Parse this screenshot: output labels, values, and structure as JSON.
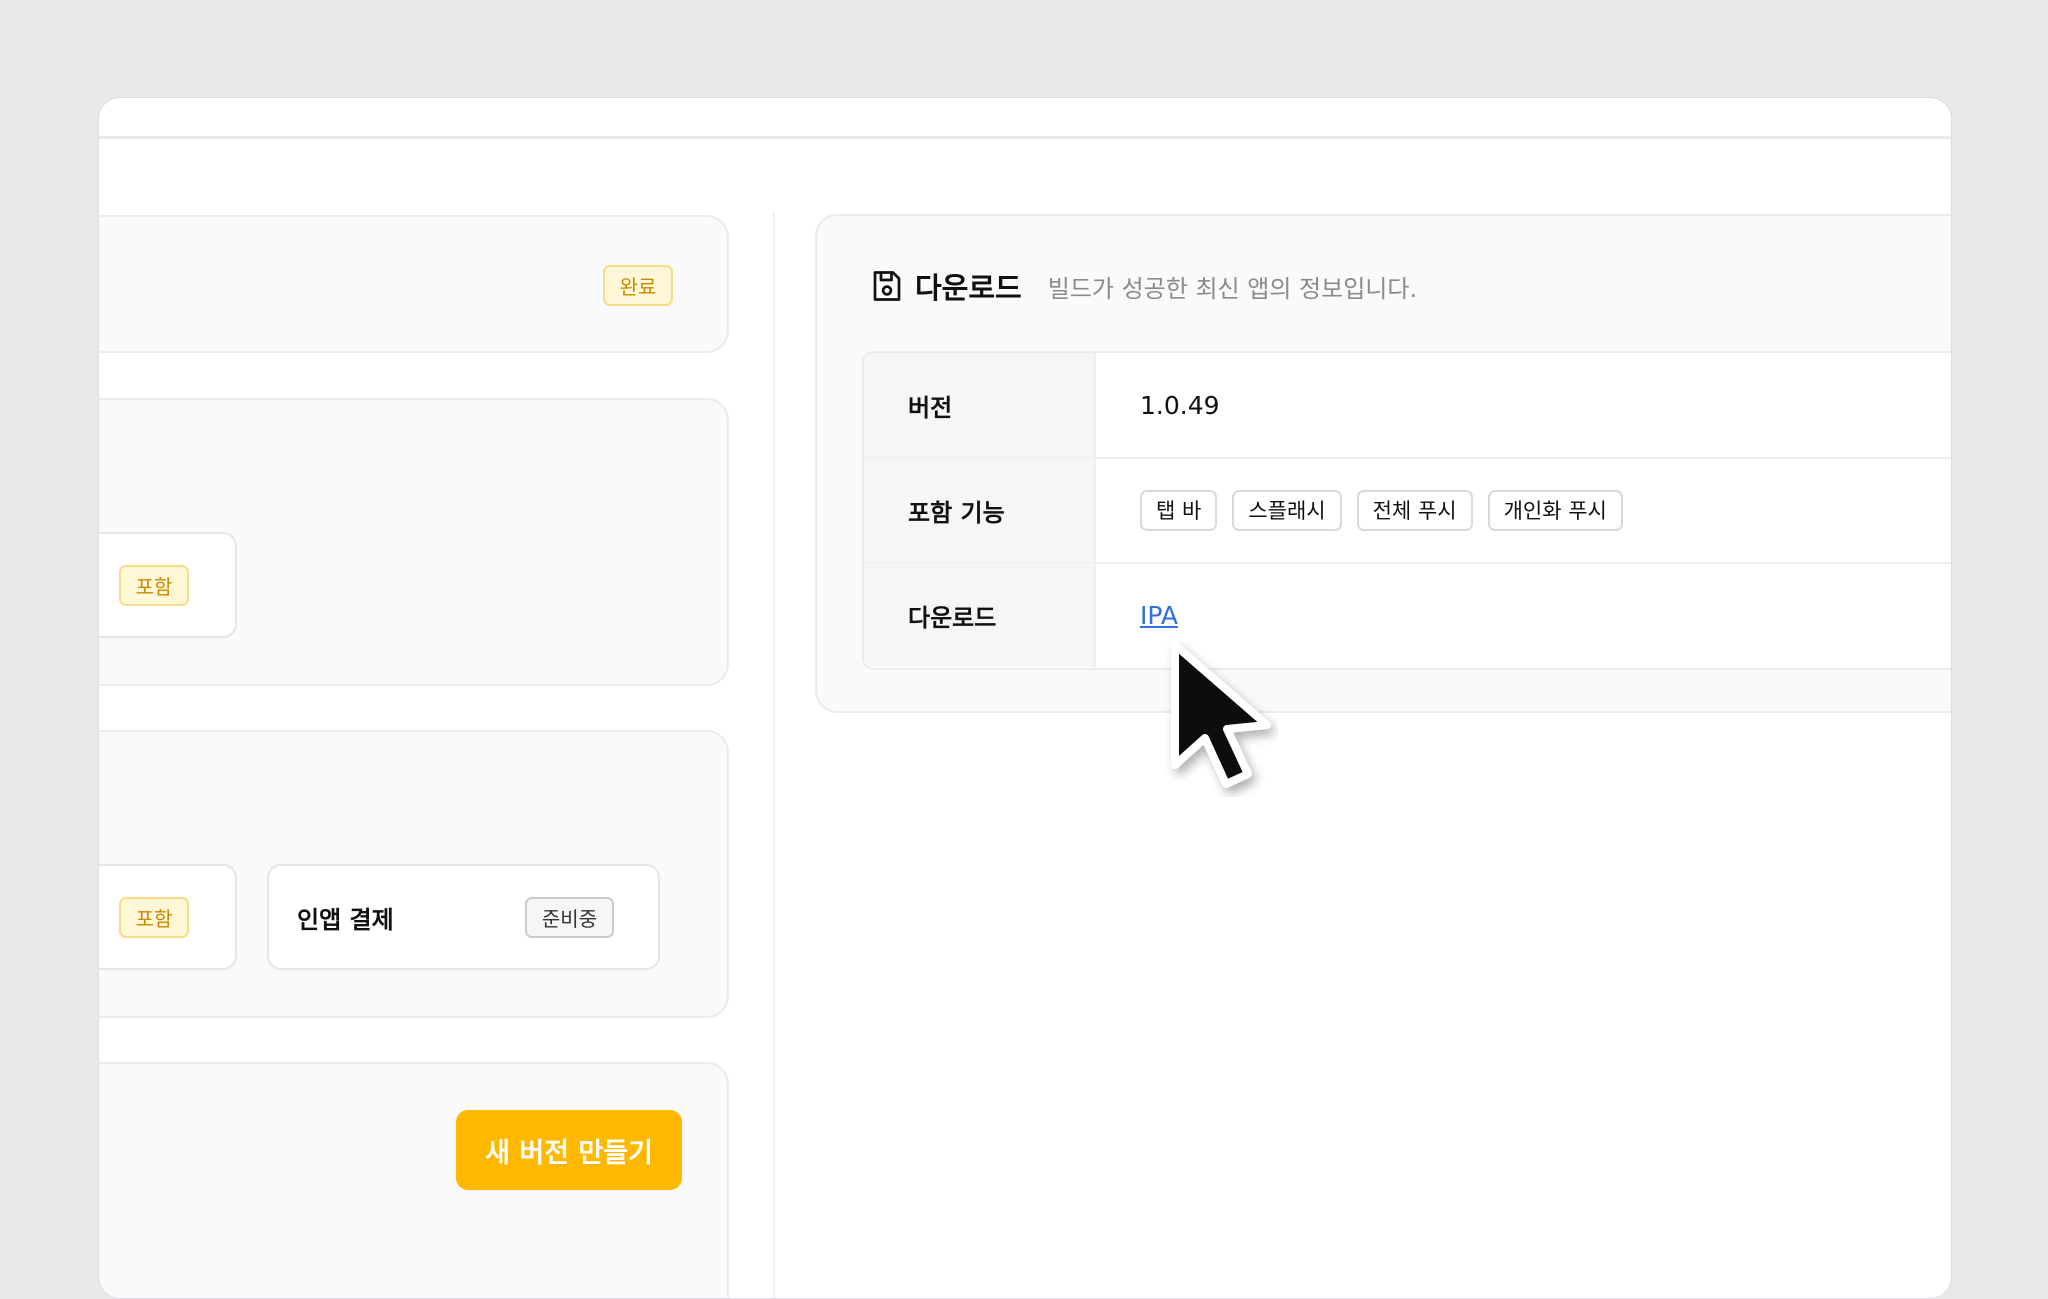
{
  "left": {
    "status_badge": "완료",
    "feature_card_1": {
      "badge": "포함"
    },
    "feature_card_2": {
      "first": {
        "badge": "포함"
      },
      "second": {
        "title": "인앱 결제",
        "badge": "준비중"
      }
    },
    "new_version_button": "새 버전 만들기"
  },
  "download": {
    "icon": "save-icon",
    "title": "다운로드",
    "description": "빌드가 성공한 최신 앱의 정보입니다.",
    "rows": [
      {
        "label": "버전",
        "value": "1.0.49"
      },
      {
        "label": "포함 기능",
        "tags": [
          "탭 바",
          "스플래시",
          "전체 푸시",
          "개인화 푸시"
        ]
      },
      {
        "label": "다운로드",
        "link": "IPA"
      }
    ]
  },
  "colors": {
    "accent": "#ffb800",
    "link": "#2f6fe0",
    "badge_yellow_text": "#c98a00"
  }
}
